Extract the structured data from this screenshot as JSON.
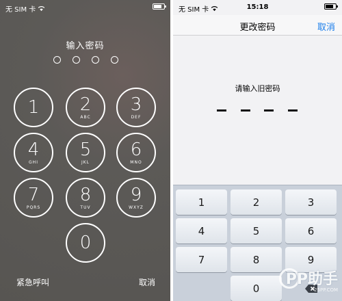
{
  "left_screen": {
    "status": {
      "carrier": "无 SIM 卡"
    },
    "prompt": "输入密码",
    "keys": [
      {
        "num": "1",
        "letters": ""
      },
      {
        "num": "2",
        "letters": "ABC"
      },
      {
        "num": "3",
        "letters": "DEF"
      },
      {
        "num": "4",
        "letters": "GHI"
      },
      {
        "num": "5",
        "letters": "JKL"
      },
      {
        "num": "6",
        "letters": "MNO"
      },
      {
        "num": "7",
        "letters": "PQRS"
      },
      {
        "num": "8",
        "letters": "TUV"
      },
      {
        "num": "9",
        "letters": "WXYZ"
      },
      {
        "num": "0",
        "letters": ""
      }
    ],
    "emergency_label": "紧急呼叫",
    "cancel_label": "取消"
  },
  "right_screen": {
    "status": {
      "carrier": "无 SIM 卡",
      "time": "15:18"
    },
    "nav_title": "更改密码",
    "cancel_label": "取消",
    "prompt": "请输入旧密码",
    "numpad": [
      "1",
      "2",
      "3",
      "4",
      "5",
      "6",
      "7",
      "8",
      "9",
      "",
      "0",
      ""
    ]
  },
  "watermark": {
    "brand": "PP助手",
    "site": "25PP.COM"
  },
  "colors": {
    "lock_bg": "#5c5a57",
    "accent_blue": "#1a7dea",
    "numpad_bg": "#c9d0da"
  },
  "icons": {
    "wifi": "wifi-icon",
    "battery": "battery-icon",
    "delete": "backspace-icon"
  }
}
